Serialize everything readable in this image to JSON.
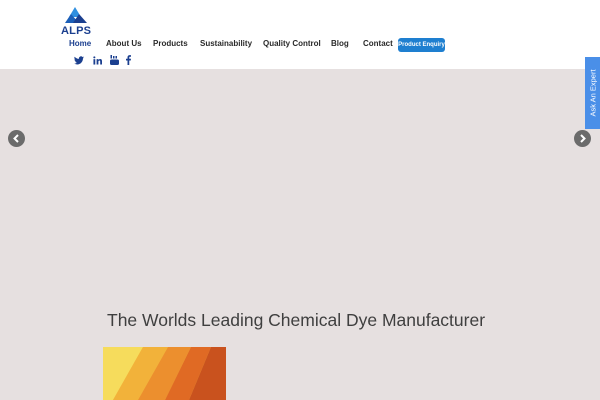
{
  "brand": {
    "name": "ALPS"
  },
  "nav": {
    "items": [
      {
        "label": "Home",
        "active": true
      },
      {
        "label": "About Us"
      },
      {
        "label": "Products"
      },
      {
        "label": "Sustainability"
      },
      {
        "label": "Quality Control"
      },
      {
        "label": "Blog"
      },
      {
        "label": "Contact"
      }
    ],
    "enquiry_label": "Product Enquiry"
  },
  "social": [
    "twitter-icon",
    "linkedin-icon",
    "youtube-icon",
    "facebook-icon"
  ],
  "side_tab": {
    "label": "Ask An Expert"
  },
  "hero": {
    "headline": "The Worlds Leading Chemical Dye Manufacturer"
  },
  "colors": {
    "brand_blue": "#1b3f8f",
    "button_blue": "#1e7fd0",
    "side_tab": "#4a8fe8",
    "hero_bg": "#e6e0e0"
  }
}
